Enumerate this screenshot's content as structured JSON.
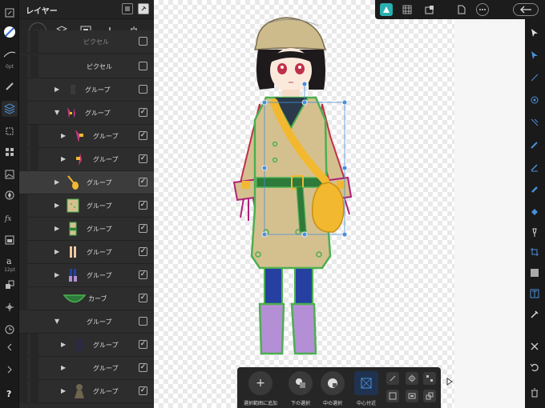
{
  "left_tools": {
    "stroke_size_label": "0pt",
    "font_size_label": "12pt"
  },
  "layers_panel": {
    "title": "レイヤー",
    "rows": [
      {
        "label": "ピクセル"
      },
      {
        "label": "ピクセル"
      },
      {
        "label": "グループ"
      },
      {
        "label": "グループ"
      },
      {
        "label": "グループ"
      },
      {
        "label": "グループ"
      },
      {
        "label": "グループ"
      },
      {
        "label": "グループ"
      },
      {
        "label": "グループ"
      },
      {
        "label": "グループ"
      },
      {
        "label": "グループ"
      },
      {
        "label": "カーブ"
      },
      {
        "label": "グループ"
      },
      {
        "label": "グループ"
      },
      {
        "label": "グループ"
      },
      {
        "label": "グループ"
      }
    ],
    "check_mark": "✓"
  },
  "context_toolbar": {
    "add_to_selection": "選択範囲に追加",
    "select_below": "下の選択",
    "select_inside": "中の選択",
    "center_near": "中心付近",
    "plus_glyph": "+"
  },
  "colors": {
    "panel_bg": "#2b2b2b",
    "accent": "#4a90d9",
    "coat": "#d4c08f",
    "outline": "#4caf50",
    "boots": "#b48fd6",
    "legs": "#2540a0",
    "bag": "#f2b830",
    "hands": "#b0207a"
  },
  "icons": [
    "back-arrow-icon",
    "more-icon",
    "document-icon",
    "grid-icon",
    "persona-icon",
    "move-icon",
    "pen-icon",
    "brush-icon",
    "layers-icon"
  ]
}
